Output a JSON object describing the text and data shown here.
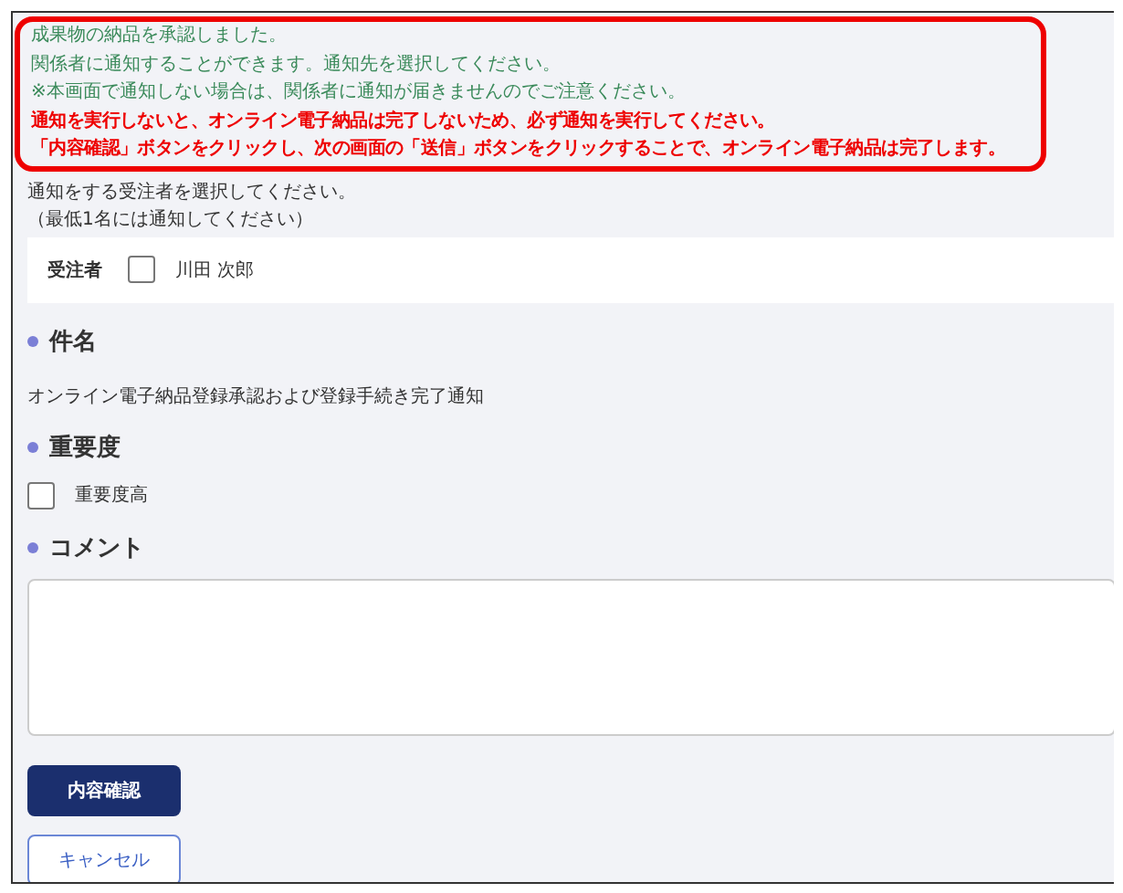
{
  "messages": [
    {
      "kind": "info",
      "text": "成果物の納品を承認しました。"
    },
    {
      "kind": "info",
      "text": "関係者に通知することができます。通知先を選択してください。"
    },
    {
      "kind": "info",
      "text": "※本画面で通知しない場合は、関係者に通知が届きませんのでご注意ください。"
    },
    {
      "kind": "warning",
      "text": "通知を実行しないと、オンライン電子納品は完了しないため、必ず通知を実行してください。"
    },
    {
      "kind": "warning",
      "text": "「内容確認」ボタンをクリックし、次の画面の「送信」ボタンをクリックすることで、オンライン電子納品は完了します。"
    }
  ],
  "recipient_prompt": [
    "通知をする受注者を選択してください。",
    "（最低1名には通知してください）"
  ],
  "recipients": {
    "label": "受注者",
    "items": [
      {
        "name": "川田 次郎",
        "checked": false
      }
    ]
  },
  "subject": {
    "heading": "件名",
    "value": "オンライン電子納品登録承認および登録手続き完了通知"
  },
  "importance": {
    "heading": "重要度",
    "option": {
      "label": "重要度高",
      "checked": false
    }
  },
  "comment": {
    "heading": "コメント"
  },
  "buttons": [
    {
      "kind": "primary",
      "label": "内容確認"
    },
    {
      "kind": "secondary",
      "label": "キャンセル"
    }
  ]
}
